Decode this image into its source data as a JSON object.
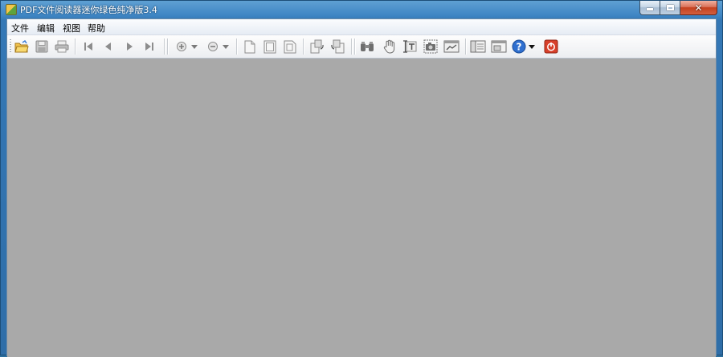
{
  "window": {
    "title": "PDF文件阅读器迷你绿色纯净版3.4"
  },
  "menu": [
    "文件",
    "编辑",
    "视图",
    "帮助"
  ],
  "colors": {
    "content_bg": "#a9a9a9",
    "exit_red": "#d8402a",
    "help_blue": "#2f6fcf"
  },
  "toolbar": [
    "open-icon",
    "save-icon",
    "print-icon",
    "first-page-icon",
    "previous-page-icon",
    "next-page-icon",
    "last-page-icon",
    "zoom-in-icon",
    "zoom-in-dropdown-icon",
    "zoom-out-icon",
    "zoom-out-dropdown-icon",
    "page-icon",
    "fit-page-icon",
    "fit-width-icon",
    "rotate-right-icon",
    "rotate-left-icon",
    "find-icon",
    "hand-tool-icon",
    "text-select-icon",
    "snapshot-icon",
    "graphics-select-icon",
    "thumbnails-icon",
    "fullscreen-icon",
    "help-icon",
    "help-dropdown-icon",
    "exit-icon"
  ]
}
